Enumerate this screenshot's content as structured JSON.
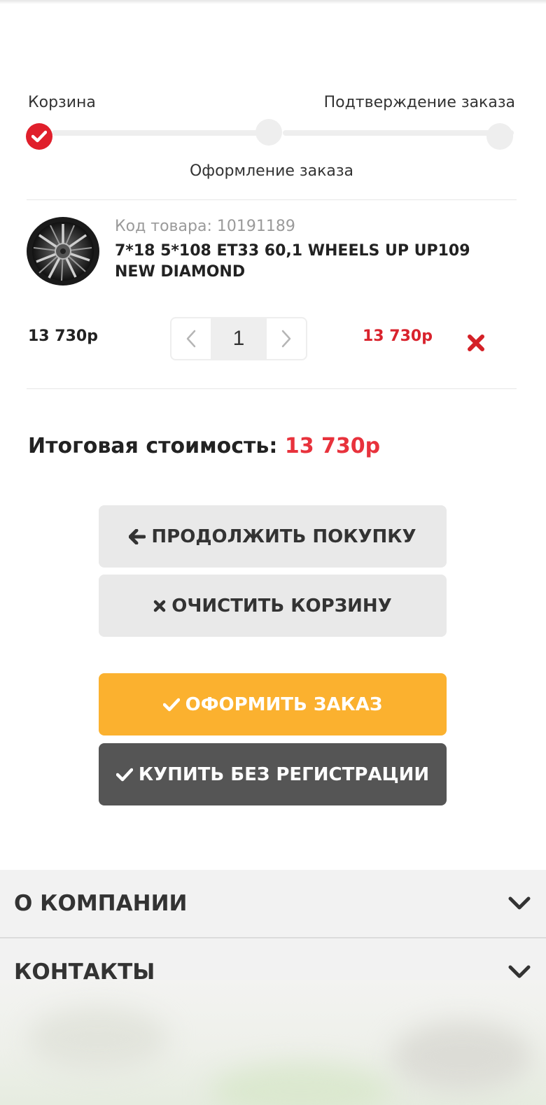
{
  "steps": {
    "step1": "Корзина",
    "step2": "Оформление заказа",
    "step3": "Подтверждение заказа",
    "current": 1
  },
  "product": {
    "code_label": "Код товара:",
    "code_value": "10191189",
    "name": "7*18 5*108 ET33 60,1 WHEELS UP UP109 NEW DIAMOND",
    "unit_price": "13 730р",
    "quantity": "1",
    "line_total": "13 730р"
  },
  "summary": {
    "label": "Итоговая стоимость:",
    "amount": "13 730р"
  },
  "buttons": {
    "continue": "ПРОДОЛЖИТЬ ПОКУПКУ",
    "clear": "ОЧИСТИТЬ КОРЗИНУ",
    "checkout": "ОФОРМИТЬ ЗАКАЗ",
    "buy_no_reg": "КУПИТЬ БЕЗ РЕГИСТРАЦИИ"
  },
  "footer": {
    "about": "О КОМПАНИИ",
    "contacts": "КОНТАКТЫ"
  },
  "colors": {
    "accent_red": "#e01f2b",
    "price_red": "#d9232d",
    "checkout_orange": "#fbb12f",
    "dark_button": "#555555",
    "light_button": "#e9e9e9"
  },
  "icons": {
    "step_done": "check-circle-icon",
    "remove": "close-x-icon",
    "continue": "arrow-left-icon",
    "clear": "times-icon",
    "checkout": "check-icon",
    "footer_toggle": "chevron-down-icon"
  }
}
